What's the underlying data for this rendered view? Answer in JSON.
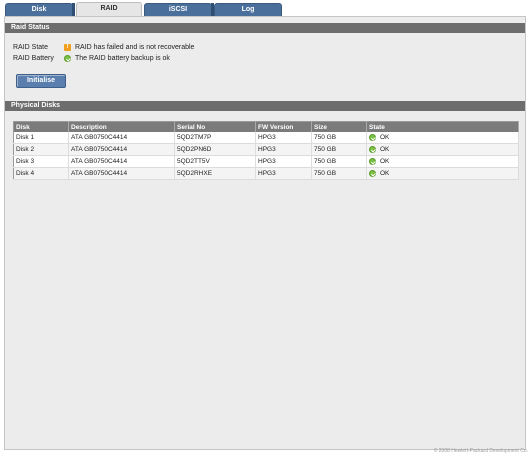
{
  "tabs": [
    {
      "label": "Disk"
    },
    {
      "label": "RAID"
    },
    {
      "label": "iSCSI"
    },
    {
      "label": "Log"
    }
  ],
  "raid_status": {
    "title": "Raid Status",
    "rows": [
      {
        "label": "RAID State",
        "icon": "warning-icon",
        "text": "RAID has failed and is not recoverable"
      },
      {
        "label": "RAID Battery",
        "icon": "ok-icon",
        "text": "The RAID battery backup is ok"
      }
    ],
    "initialise_label": "Initialise"
  },
  "physical_disks": {
    "title": "Physical Disks",
    "columns": [
      "Disk",
      "Description",
      "Serial No",
      "FW Version",
      "Size",
      "State"
    ],
    "rows": [
      {
        "disk": "Disk 1",
        "description": "ATA GB0750C4414",
        "serial": "5QD2TM7P",
        "fw": "HPG3",
        "size": "750 GB",
        "state": "OK"
      },
      {
        "disk": "Disk 2",
        "description": "ATA GB0750C4414",
        "serial": "5QD2PN6D",
        "fw": "HPG3",
        "size": "750 GB",
        "state": "OK"
      },
      {
        "disk": "Disk 3",
        "description": "ATA GB0750C4414",
        "serial": "5QD2TT5V",
        "fw": "HPG3",
        "size": "750 GB",
        "state": "OK"
      },
      {
        "disk": "Disk 4",
        "description": "ATA GB0750C4414",
        "serial": "5QD2RHXE",
        "fw": "HPG3",
        "size": "750 GB",
        "state": "OK"
      }
    ]
  },
  "colors": {
    "tab_blue": "#4a6f9b",
    "header_gray": "#6d6d6d",
    "ok_green": "#7ac043",
    "warning_orange": "#f0a020"
  },
  "footer": {
    "text": "© 2008 Hewlett-Packard Development Co."
  }
}
